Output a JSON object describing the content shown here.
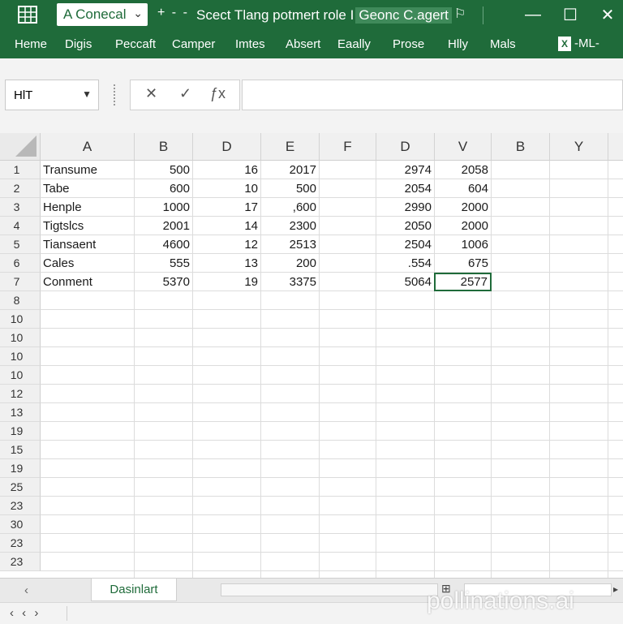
{
  "titlebar": {
    "autosave_label": "A Conecal",
    "nav_controls": "+ - -",
    "title_text": "Scect Tlang potmert role I",
    "title_highlight": "Geonc C.agert",
    "flag_glyph": "⚐",
    "min_glyph": "—",
    "max_glyph": "☐",
    "close_glyph": "✕",
    "accent_color": "#1f6b3a"
  },
  "ribbon": {
    "tabs": [
      "Heme",
      "Digis",
      "Peccaft",
      "Camper",
      "Imtes",
      "Absert",
      "Eaally",
      "Prose",
      "Hlly",
      "Mals"
    ],
    "xml_label": "-ML-"
  },
  "formula_bar": {
    "name_box": "HlT",
    "cancel_glyph": "✕",
    "enter_glyph": "✓",
    "fx_glyph": "ƒx",
    "content": ""
  },
  "grid": {
    "columns": [
      "A",
      "B",
      "D",
      "E",
      "F",
      "D",
      "V",
      "B",
      "Y"
    ],
    "row_numbers": [
      "1",
      "2",
      "3",
      "4",
      "5",
      "6",
      "7",
      "8",
      "10",
      "10",
      "10",
      "10",
      "12",
      "13",
      "19",
      "15",
      "19",
      "25",
      "23",
      "30",
      "23",
      "23"
    ],
    "rows": [
      [
        "Transume",
        "500",
        "16",
        "2017",
        "",
        "2974",
        "2058"
      ],
      [
        "Tabe",
        "600",
        "10",
        "500",
        "",
        "2054",
        "604"
      ],
      [
        "Henple",
        "1000",
        "17",
        ",600",
        "",
        "2990",
        "2000"
      ],
      [
        "Tigtslcs",
        "2001",
        "14",
        "2300",
        "",
        "2050",
        "2000"
      ],
      [
        "Tiansaent",
        "4600",
        "12",
        "2513",
        "",
        "2504",
        "1006"
      ],
      [
        "Cales",
        "555",
        "13",
        "200",
        "",
        ".554",
        "675"
      ],
      [
        "Conment",
        "5370",
        "19",
        "3375",
        "",
        "5064",
        "2577"
      ]
    ],
    "active_cell": "2577"
  },
  "sheetbar": {
    "tab_label": "Dasinlart",
    "scroll_glyph": "‹",
    "zoom_glyph": "⊞"
  },
  "statusbar": {
    "nav": "‹ ‹ ›"
  },
  "watermark": "pollinations.ai"
}
